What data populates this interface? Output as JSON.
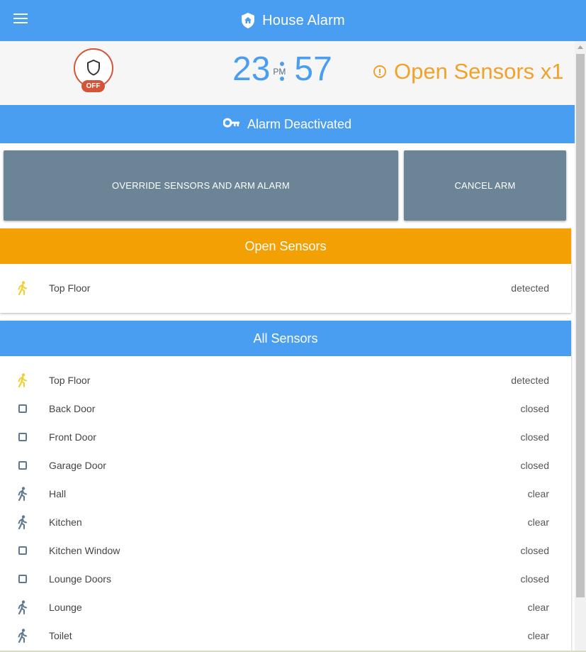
{
  "header": {
    "title": "House Alarm"
  },
  "status": {
    "badge": "OFF",
    "clock": {
      "hours": "23",
      "minutes": "57",
      "ampm": "PM"
    },
    "open_summary": "Open Sensors x1"
  },
  "banner": {
    "label": "Alarm Deactivated"
  },
  "actions": {
    "override_label": "OVERRIDE SENSORS AND ARM ALARM",
    "cancel_label": "CANCEL ARM"
  },
  "open_sensors": {
    "title": "Open Sensors",
    "items": [
      {
        "name": "Top Floor",
        "state": "detected",
        "icon": "motion-active"
      }
    ]
  },
  "all_sensors": {
    "title": "All Sensors",
    "items": [
      {
        "name": "Top Floor",
        "state": "detected",
        "icon": "motion-active"
      },
      {
        "name": "Back Door",
        "state": "closed",
        "icon": "door-checkbox"
      },
      {
        "name": "Front Door",
        "state": "closed",
        "icon": "door-checkbox"
      },
      {
        "name": "Garage Door",
        "state": "closed",
        "icon": "door-checkbox"
      },
      {
        "name": "Hall",
        "state": "clear",
        "icon": "motion"
      },
      {
        "name": "Kitchen",
        "state": "clear",
        "icon": "motion"
      },
      {
        "name": "Kitchen Window",
        "state": "closed",
        "icon": "door-checkbox"
      },
      {
        "name": "Lounge Doors",
        "state": "closed",
        "icon": "door-checkbox"
      },
      {
        "name": "Lounge",
        "state": "clear",
        "icon": "motion"
      },
      {
        "name": "Toilet",
        "state": "clear",
        "icon": "motion"
      }
    ]
  },
  "colors": {
    "primary": "#4a9ef2",
    "warning": "#f3a004",
    "danger": "#d35438",
    "button": "#6b8496",
    "motion_active": "#f2cf2f",
    "motion_idle": "#5f7a90"
  }
}
